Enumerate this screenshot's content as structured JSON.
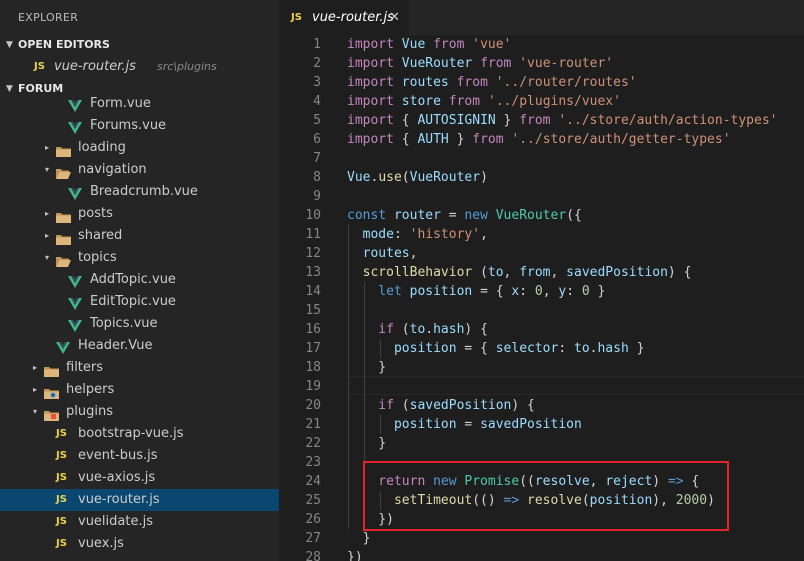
{
  "sidebar": {
    "title": "EXPLORER",
    "open_editors_label": "OPEN EDITORS",
    "open_editor": {
      "icon": "JS",
      "name": "vue-router.js",
      "path": "src\\plugins"
    },
    "project_label": "FORUM"
  },
  "tree": [
    {
      "name": "Form.vue",
      "icon": "vue",
      "indent": 68
    },
    {
      "name": "Forums.vue",
      "icon": "vue",
      "indent": 68
    },
    {
      "name": "loading",
      "icon": "folder",
      "arrow": "▸",
      "indent": 56
    },
    {
      "name": "navigation",
      "icon": "folder-open",
      "arrow": "▾",
      "indent": 56
    },
    {
      "name": "Breadcrumb.vue",
      "icon": "vue",
      "indent": 68
    },
    {
      "name": "posts",
      "icon": "folder",
      "arrow": "▸",
      "indent": 56
    },
    {
      "name": "shared",
      "icon": "folder",
      "arrow": "▸",
      "indent": 56
    },
    {
      "name": "topics",
      "icon": "folder-open",
      "arrow": "▾",
      "indent": 56
    },
    {
      "name": "AddTopic.vue",
      "icon": "vue",
      "indent": 68
    },
    {
      "name": "EditTopic.vue",
      "icon": "vue",
      "indent": 68
    },
    {
      "name": "Topics.vue",
      "icon": "vue",
      "indent": 68
    },
    {
      "name": "Header.Vue",
      "icon": "vue",
      "indent": 56
    },
    {
      "name": "filters",
      "icon": "folder",
      "arrow": "▸",
      "indent": 44
    },
    {
      "name": "helpers",
      "icon": "folder-gear",
      "arrow": "▸",
      "indent": 44
    },
    {
      "name": "plugins",
      "icon": "folder-plugin",
      "arrow": "▾",
      "indent": 44
    },
    {
      "name": "bootstrap-vue.js",
      "icon": "js",
      "indent": 56
    },
    {
      "name": "event-bus.js",
      "icon": "js",
      "indent": 56
    },
    {
      "name": "vue-axios.js",
      "icon": "js",
      "indent": 56
    },
    {
      "name": "vue-router.js",
      "icon": "js",
      "indent": 56,
      "active": true
    },
    {
      "name": "vuelidate.js",
      "icon": "js",
      "indent": 56
    },
    {
      "name": "vuex.js",
      "icon": "js",
      "indent": 56
    }
  ],
  "tab": {
    "icon": "JS",
    "name": "vue-router.js",
    "close": "✕"
  },
  "code": [
    [
      [
        "import ",
        "kp"
      ],
      [
        "Vue ",
        "vr"
      ],
      [
        "from ",
        "kp"
      ],
      [
        "'vue'",
        "st"
      ]
    ],
    [
      [
        "import ",
        "kp"
      ],
      [
        "VueRouter ",
        "vr"
      ],
      [
        "from ",
        "kp"
      ],
      [
        "'vue-router'",
        "st"
      ]
    ],
    [
      [
        "import ",
        "kp"
      ],
      [
        "routes ",
        "vr"
      ],
      [
        "from ",
        "kp"
      ],
      [
        "'../router/routes'",
        "st"
      ]
    ],
    [
      [
        "import ",
        "kp"
      ],
      [
        "store ",
        "vr"
      ],
      [
        "from ",
        "kp"
      ],
      [
        "'../plugins/vuex'",
        "st"
      ]
    ],
    [
      [
        "import ",
        "kp"
      ],
      [
        "{ ",
        "pl"
      ],
      [
        "AUTOSIGNIN ",
        "vr"
      ],
      [
        "} ",
        "pl"
      ],
      [
        "from ",
        "kp"
      ],
      [
        "'../store/auth/action-types'",
        "st"
      ]
    ],
    [
      [
        "import ",
        "kp"
      ],
      [
        "{ ",
        "pl"
      ],
      [
        "AUTH ",
        "vr"
      ],
      [
        "} ",
        "pl"
      ],
      [
        "from ",
        "kp"
      ],
      [
        "'../store/auth/getter-types'",
        "st"
      ]
    ],
    [],
    [
      [
        "Vue",
        "vr"
      ],
      [
        ".",
        "pl"
      ],
      [
        "use",
        "fn"
      ],
      [
        "(",
        "pl"
      ],
      [
        "VueRouter",
        "vr"
      ],
      [
        ")",
        "pl"
      ]
    ],
    [],
    [
      [
        "const ",
        "kw"
      ],
      [
        "router ",
        "vr"
      ],
      [
        "= ",
        "pl"
      ],
      [
        "new ",
        "kw"
      ],
      [
        "VueRouter",
        "ty"
      ],
      [
        "({",
        "pl"
      ]
    ],
    [
      [
        "  mode",
        "vr"
      ],
      [
        ": ",
        "pl"
      ],
      [
        "'history'",
        "st"
      ],
      [
        ",",
        "pl"
      ]
    ],
    [
      [
        "  routes",
        "vr"
      ],
      [
        ",",
        "pl"
      ]
    ],
    [
      [
        "  scrollBehavior ",
        "fn"
      ],
      [
        "(",
        "pl"
      ],
      [
        "to",
        "vr"
      ],
      [
        ", ",
        "pl"
      ],
      [
        "from",
        "vr"
      ],
      [
        ", ",
        "pl"
      ],
      [
        "savedPosition",
        "vr"
      ],
      [
        ") {",
        "pl"
      ]
    ],
    [
      [
        "    let ",
        "kw"
      ],
      [
        "position ",
        "vr"
      ],
      [
        "= { ",
        "pl"
      ],
      [
        "x",
        "vr"
      ],
      [
        ": ",
        "pl"
      ],
      [
        "0",
        "nu"
      ],
      [
        ", ",
        "pl"
      ],
      [
        "y",
        "vr"
      ],
      [
        ": ",
        "pl"
      ],
      [
        "0",
        "nu"
      ],
      [
        " }",
        "pl"
      ]
    ],
    [],
    [
      [
        "    if ",
        "kp"
      ],
      [
        "(",
        "pl"
      ],
      [
        "to",
        "vr"
      ],
      [
        ".",
        "pl"
      ],
      [
        "hash",
        "vr"
      ],
      [
        ") {",
        "pl"
      ]
    ],
    [
      [
        "      position ",
        "vr"
      ],
      [
        "= { ",
        "pl"
      ],
      [
        "selector",
        "vr"
      ],
      [
        ": ",
        "pl"
      ],
      [
        "to",
        "vr"
      ],
      [
        ".",
        "pl"
      ],
      [
        "hash",
        "vr"
      ],
      [
        " }",
        "pl"
      ]
    ],
    [
      [
        "    }",
        "pl"
      ]
    ],
    [],
    [
      [
        "    if ",
        "kp"
      ],
      [
        "(",
        "pl"
      ],
      [
        "savedPosition",
        "vr"
      ],
      [
        ") {",
        "pl"
      ]
    ],
    [
      [
        "      position ",
        "vr"
      ],
      [
        "= ",
        "pl"
      ],
      [
        "savedPosition",
        "vr"
      ]
    ],
    [
      [
        "    }",
        "pl"
      ]
    ],
    [],
    [
      [
        "    return ",
        "kp"
      ],
      [
        "new ",
        "kw"
      ],
      [
        "Promise",
        "ty"
      ],
      [
        "((",
        "pl"
      ],
      [
        "resolve",
        "vr"
      ],
      [
        ", ",
        "pl"
      ],
      [
        "reject",
        "vr"
      ],
      [
        ") ",
        "pl"
      ],
      [
        "=> ",
        "kw"
      ],
      [
        "{",
        "pl"
      ]
    ],
    [
      [
        "      setTimeout",
        "fn"
      ],
      [
        "(() ",
        "pl"
      ],
      [
        "=> ",
        "kw"
      ],
      [
        "resolve",
        "fn"
      ],
      [
        "(",
        "pl"
      ],
      [
        "position",
        "vr"
      ],
      [
        "), ",
        "pl"
      ],
      [
        "2000",
        "nu"
      ],
      [
        ")",
        "pl"
      ]
    ],
    [
      [
        "    })",
        "pl"
      ]
    ],
    [
      [
        "  }",
        "pl"
      ]
    ],
    [
      [
        "})",
        "pl"
      ]
    ]
  ]
}
